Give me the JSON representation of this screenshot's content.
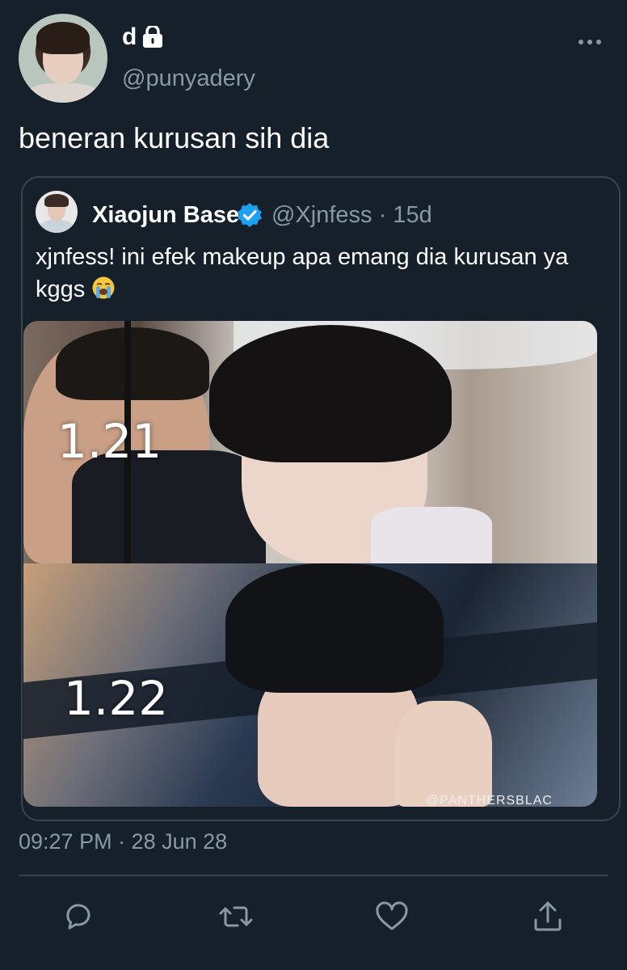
{
  "author": {
    "display_name": "d",
    "handle": "@punyadery",
    "avatar_icon": "avatar",
    "lock_icon": "lock-icon"
  },
  "tweet": {
    "text": "beneran kurusan sih dia",
    "timestamp": "09:27 PM · 28 Jun 28"
  },
  "quoted": {
    "display_name": "Xiaojun Base",
    "handle_time": "@Xjnfess · 15d",
    "text": "xjnfess! ini efek makeup apa emang dia kurusan ya kggs",
    "emoji": "loudly-crying-face",
    "media": {
      "top_label": "1.21",
      "bottom_label": "1.22",
      "watermark": "@PANTHERSBLAC"
    }
  },
  "actions": [
    "reply-icon",
    "retweet-icon",
    "like-icon",
    "share-icon"
  ],
  "colors": {
    "background": "#15202b",
    "secondary_text": "#8899a6",
    "border": "#38444d",
    "verified": "#1da1f2"
  }
}
